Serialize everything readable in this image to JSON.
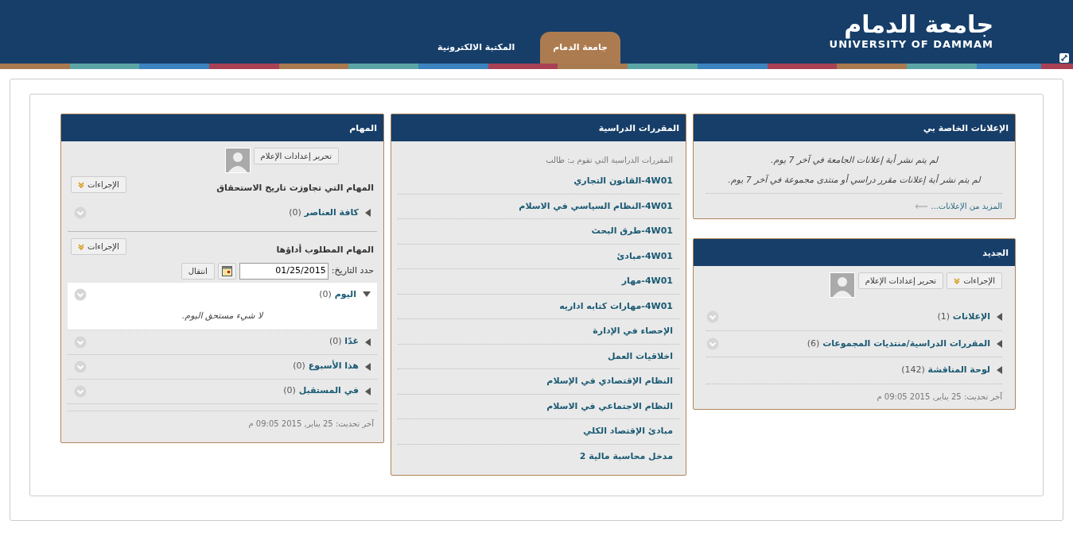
{
  "header": {
    "logo_arabic": "جامعة الدمام",
    "logo_english": "UNIVERSITY OF DAMMAM",
    "tabs": [
      {
        "label": "جامعة الدمام",
        "selected": true
      },
      {
        "label": "المكتبة الالكترونية",
        "selected": false
      }
    ]
  },
  "announcements": {
    "title": "الإعلانات الخاصة بي",
    "messages": [
      "لم يتم نشر أية إعلانات الجامعة في آخر 7 يوم.",
      "لم يتم نشر أية إعلانات مقرر دراسي أو منتدى مجموعة في آخر 7 يوم."
    ],
    "more_link": "المزيد من الإعلانات..."
  },
  "new": {
    "title": "الجديد",
    "actions_button": "الإجراءات",
    "edit_button": "تحرير إعدادات الإعلام",
    "items": [
      {
        "label": "الإعلانات",
        "count": "(1)",
        "has_menu": true
      },
      {
        "label": "المقررات الدراسية/منتديات المجموعات",
        "count": "(6)",
        "has_menu": true
      },
      {
        "label": "لوحة المناقشة",
        "count": "(142)",
        "has_menu": false
      }
    ],
    "updated": "آخر تحديث: 25 يناير, 2015 09:05 م"
  },
  "courses": {
    "title": "المقررات الدراسية",
    "caption": "المقررات الدراسية التي تقوم بـ: طالب",
    "items": [
      {
        "label": "4W01-القانون التجاري"
      },
      {
        "label": "4W01-النظام السياسي في الاسلام"
      },
      {
        "label": "4W01-طرق البحث"
      },
      {
        "label": "4W01-مبادئ"
      },
      {
        "label": "4W01-مهار"
      },
      {
        "label": "4W01-مهارات كتابه اداريه"
      },
      {
        "label": "الإحصاء في الإدارة"
      },
      {
        "label": "اخلاقيات العمل"
      },
      {
        "label": "النظام الإقتصادي في الإسلام"
      },
      {
        "label": "النظام الاجتماعي في الاسلام"
      },
      {
        "label": "مبادئ الإقتصاد الكلي"
      },
      {
        "label": "مدخل محاسبة مالية 2"
      }
    ]
  },
  "tasks": {
    "title": "المهام",
    "edit_button": "تحرير إعدادات الإعلام",
    "overdue": {
      "heading": "المهام التي تجاوزت تاريخ الاستحقاق",
      "actions_button": "الإجراءات",
      "groups": [
        {
          "label": "كافة العناصر",
          "count": "(0)",
          "expanded": false
        }
      ]
    },
    "due": {
      "heading": "المهام المطلوب أداؤها",
      "actions_button": "الإجراءات",
      "date_label": "حدد التاريخ:",
      "date_value": "01/25/2015",
      "go_button": "انتقال",
      "groups": [
        {
          "label": "اليوم",
          "count": "(0)",
          "expanded": true,
          "empty_message": "لا شيء مستحق اليوم."
        },
        {
          "label": "غدًا",
          "count": "(0)",
          "expanded": false
        },
        {
          "label": "هذا الأسبوع",
          "count": "(0)",
          "expanded": false
        },
        {
          "label": "في المستقبل",
          "count": "(0)",
          "expanded": false
        }
      ]
    },
    "updated": "آخر تحديث: 25 يناير, 2015 09:05 م"
  }
}
